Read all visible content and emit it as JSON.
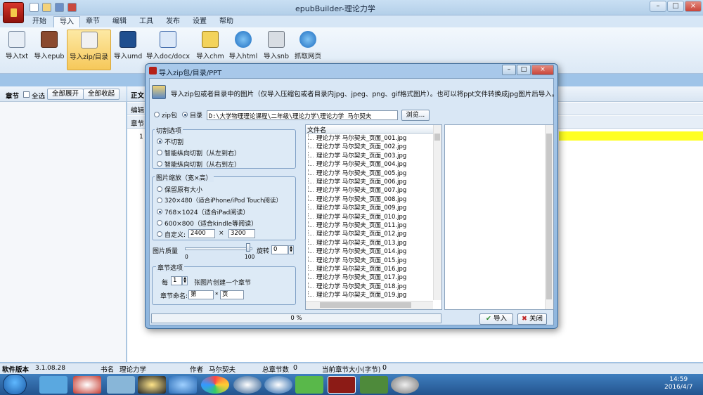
{
  "app": {
    "title": "epubBuilder-理论力学"
  },
  "tabs": [
    "开始",
    "导入",
    "章节",
    "编辑",
    "工具",
    "发布",
    "设置",
    "帮助"
  ],
  "active_tab": "导入",
  "ribbon": {
    "buttons": [
      {
        "label": "导入txt",
        "icon": "import-txt-icon"
      },
      {
        "label": "导入epub",
        "icon": "import-epub-icon"
      },
      {
        "label": "导入zip/目录",
        "icon": "zip-folder-icon"
      },
      {
        "label": "导入umd",
        "icon": "umd-icon"
      },
      {
        "label": "导入doc/docx",
        "icon": "word-doc-icon"
      },
      {
        "label": "导入chm",
        "icon": "chm-help-icon"
      },
      {
        "label": "导入html",
        "icon": "ie-html-icon"
      },
      {
        "label": "导入snb",
        "icon": "snb-icon"
      },
      {
        "label": "抓取网页",
        "icon": "ie-web-icon"
      }
    ],
    "active_index": 2
  },
  "left_panel": {
    "title": "章节",
    "select_all": "全选",
    "expand_all": "全部展开",
    "collapse_all": "全部收起",
    "rows": [
      "1"
    ]
  },
  "right_panel": {
    "strip_labels": [
      "正文",
      "编辑",
      "章节"
    ]
  },
  "dialog": {
    "title": "导入zip包/目录/PPT",
    "info": "导入zip包或者目录中的图片（仅导入压缩包或者目录内jpg、jpeg、png、gif格式图片）。也可以将ppt文件转换成jpg图片后导入。",
    "source": {
      "option_zip": "zip包",
      "option_dir": "目录",
      "selected": "目录",
      "path": "D:\\大学物理理论课程\\二年级\\理论力学\\理论力学 马尔契夫",
      "browse": "浏览..."
    },
    "cut_options": {
      "title": "切割选项",
      "items": [
        "不切割",
        "智能纵向切割（从左到右）",
        "智能纵向切割（从右到左）"
      ],
      "selected_index": 0
    },
    "scale": {
      "title": "图片缩放（宽×高）",
      "items": [
        "保留原有大小",
        "320×480（适合iPhone/iPod Touch阅读）",
        "768×1024（适合iPad阅读）",
        "600×800（适合kindle等阅读）",
        "自定义:"
      ],
      "selected_index": 2,
      "custom_w": "2400",
      "custom_x": "×",
      "custom_h": "3200"
    },
    "quality": {
      "label": "图片质量",
      "min": "0",
      "max": "100",
      "value_pct": 95,
      "rotate_label": "旋转",
      "rotate_value": "0"
    },
    "chapter": {
      "title": "章节选项",
      "each": "每",
      "count": "1",
      "unit_text": "张图片创建一个章节",
      "name_label": "章节命名:",
      "prefix": "第",
      "star": "*",
      "suffix": "页"
    },
    "file_list": {
      "header": "文件名",
      "files": [
        "理论力学 马尔契夫_页面_001.jpg",
        "理论力学 马尔契夫_页面_002.jpg",
        "理论力学 马尔契夫_页面_003.jpg",
        "理论力学 马尔契夫_页面_004.jpg",
        "理论力学 马尔契夫_页面_005.jpg",
        "理论力学 马尔契夫_页面_006.jpg",
        "理论力学 马尔契夫_页面_007.jpg",
        "理论力学 马尔契夫_页面_008.jpg",
        "理论力学 马尔契夫_页面_009.jpg",
        "理论力学 马尔契夫_页面_010.jpg",
        "理论力学 马尔契夫_页面_011.jpg",
        "理论力学 马尔契夫_页面_012.jpg",
        "理论力学 马尔契夫_页面_013.jpg",
        "理论力学 马尔契夫_页面_014.jpg",
        "理论力学 马尔契夫_页面_015.jpg",
        "理论力学 马尔契夫_页面_016.jpg",
        "理论力学 马尔契夫_页面_017.jpg",
        "理论力学 马尔契夫_页面_018.jpg",
        "理论力学 马尔契夫_页面_019.jpg"
      ]
    },
    "progress": {
      "text": "0 %",
      "value_pct": 0
    },
    "import_button": "导入",
    "close_button": "关闭"
  },
  "status": {
    "version_label": "软件版本",
    "version": "3.1.08.28",
    "book_label": "书名",
    "book": "理论力学",
    "author_label": "作者",
    "author": "马尔契夫",
    "total_label": "总章节数",
    "total": "0",
    "current_label": "当前章节大小(字节)",
    "current": "0"
  },
  "taskbar": {
    "time": "14:59",
    "date": "2016/4/7"
  },
  "watermark": {
    "brand": "Bai du 经验",
    "url": "jingyan.baidu.com"
  }
}
